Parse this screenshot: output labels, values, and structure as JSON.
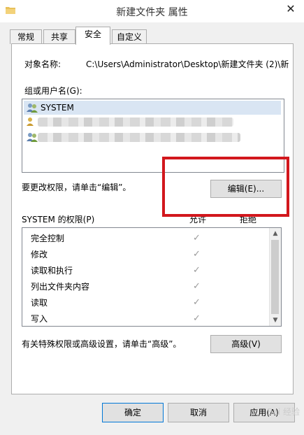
{
  "window": {
    "title": "新建文件夹 属性",
    "close_glyph": "✕"
  },
  "tabs": [
    {
      "label": "常规",
      "active": false
    },
    {
      "label": "共享",
      "active": false
    },
    {
      "label": "安全",
      "active": true
    },
    {
      "label": "自定义",
      "active": false
    }
  ],
  "security": {
    "object_label": "对象名称:",
    "object_value": "C:\\Users\\Administrator\\Desktop\\新建文件夹 (2)\\新",
    "group_label": "组或用户名(G):",
    "users": [
      {
        "name": "SYSTEM",
        "selected": true,
        "icon": "user-group-icon"
      },
      {
        "name": "",
        "selected": false,
        "icon": "user-group-icon"
      },
      {
        "name": "",
        "selected": false,
        "icon": "user-group-icon"
      }
    ],
    "edit_note": "要更改权限，请单击“编辑”。",
    "edit_button": "编辑(E)...",
    "permissions_label": "SYSTEM 的权限(P)",
    "allow_header": "允许",
    "deny_header": "拒绝",
    "permissions": [
      {
        "name": "完全控制",
        "allow": "✓"
      },
      {
        "name": "修改",
        "allow": "✓"
      },
      {
        "name": "读取和执行",
        "allow": "✓"
      },
      {
        "name": "列出文件夹内容",
        "allow": "✓"
      },
      {
        "name": "读取",
        "allow": "✓"
      },
      {
        "name": "写入",
        "allow": "✓"
      }
    ],
    "advanced_note": "有关特殊权限或高级设置，请单击“高级”。",
    "advanced_button": "高级(V)"
  },
  "footer": {
    "ok": "确定",
    "cancel": "取消",
    "apply": "应用(A)"
  },
  "watermark": "Bai 经验",
  "colors": {
    "highlight": "#d2171d",
    "selection": "#d9e5f3"
  }
}
